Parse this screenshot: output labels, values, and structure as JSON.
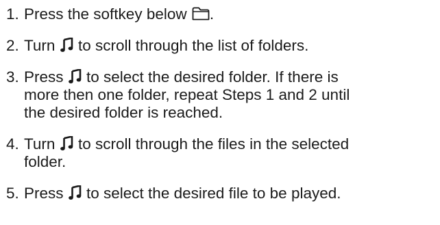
{
  "steps": [
    {
      "number": "1.",
      "lines": [
        {
          "before": "Press the softkey below ",
          "icon": "folder-icon",
          "after": "."
        }
      ]
    },
    {
      "number": "2.",
      "lines": [
        {
          "before": "Turn ",
          "icon": "music-note-icon",
          "after": " to scroll through the list of folders."
        }
      ]
    },
    {
      "number": "3.",
      "lines": [
        {
          "before": "Press ",
          "icon": "music-note-icon",
          "after": " to select the desired folder. If there is"
        },
        {
          "text": "more then one folder, repeat Steps 1 and 2 until"
        },
        {
          "text": "the desired folder is reached."
        }
      ]
    },
    {
      "number": "4.",
      "lines": [
        {
          "before": "Turn ",
          "icon": "music-note-icon",
          "after": " to scroll through the files in the selected"
        },
        {
          "text": "folder."
        }
      ]
    },
    {
      "number": "5.",
      "lines": [
        {
          "before": "Press ",
          "icon": "music-note-icon",
          "after": " to select the desired file to be played."
        }
      ]
    }
  ]
}
